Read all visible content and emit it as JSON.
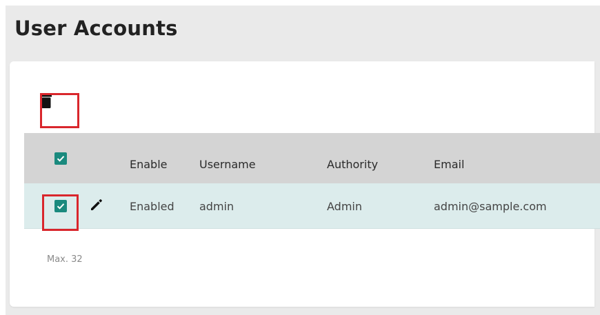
{
  "header": {
    "title": "User Accounts"
  },
  "toolbar": {
    "delete_icon": "trash-icon"
  },
  "table": {
    "columns": [
      "Enable",
      "Username",
      "Authority",
      "Email"
    ],
    "select_all_checked": true,
    "rows": [
      {
        "checked": true,
        "edit_icon": "pencil-icon",
        "enable": "Enabled",
        "username": "admin",
        "authority": "Admin",
        "email": "admin@sample.com"
      }
    ]
  },
  "footer": {
    "max_note": "Max. 32"
  },
  "colors": {
    "checkbox": "#1a8a7e",
    "header_row": "#d4d4d4",
    "selected_row": "#dcecec",
    "highlight": "#d9262c"
  }
}
